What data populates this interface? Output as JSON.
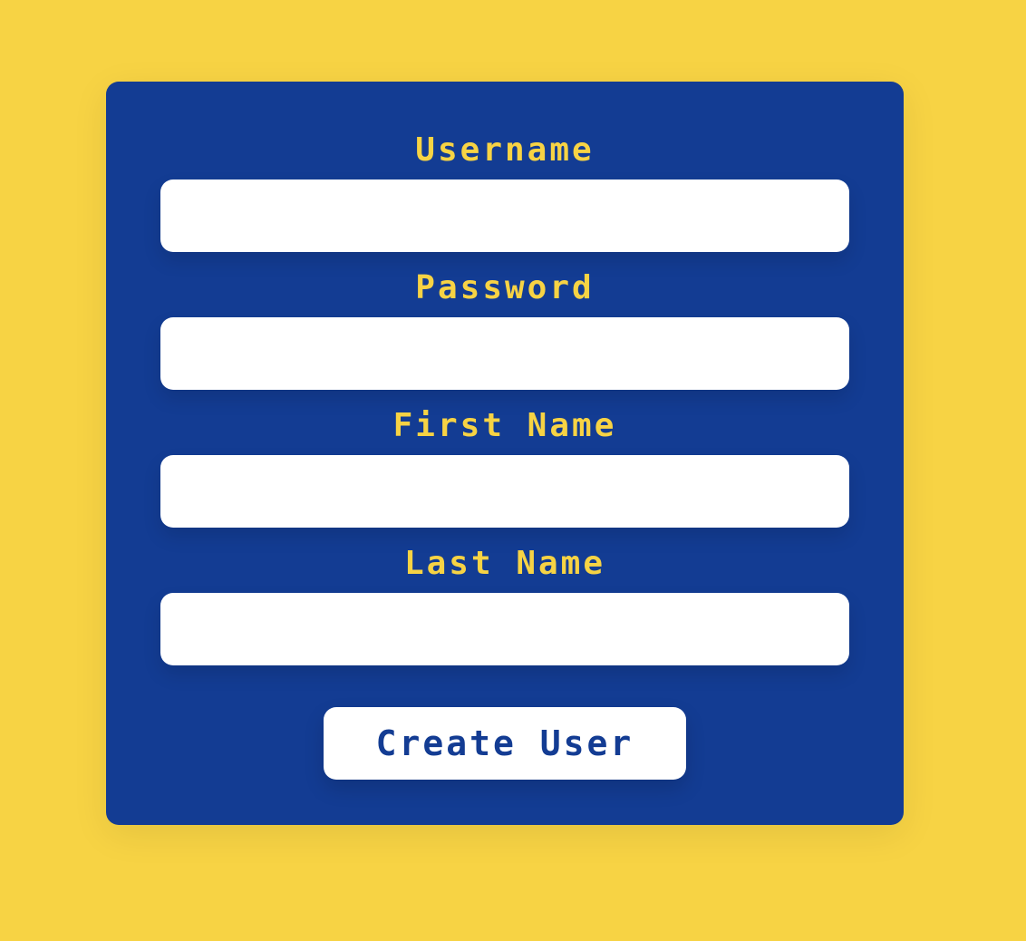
{
  "form": {
    "fields": [
      {
        "label": "Username",
        "value": "",
        "placeholder": ""
      },
      {
        "label": "Password",
        "value": "",
        "placeholder": ""
      },
      {
        "label": "First Name",
        "value": "",
        "placeholder": ""
      },
      {
        "label": "Last Name",
        "value": "",
        "placeholder": ""
      }
    ],
    "submit_label": "Create User"
  },
  "colors": {
    "page_background": "#f7d344",
    "card_background": "#133c93",
    "label_text": "#f7d344",
    "input_background": "#ffffff",
    "button_text": "#133c93"
  }
}
